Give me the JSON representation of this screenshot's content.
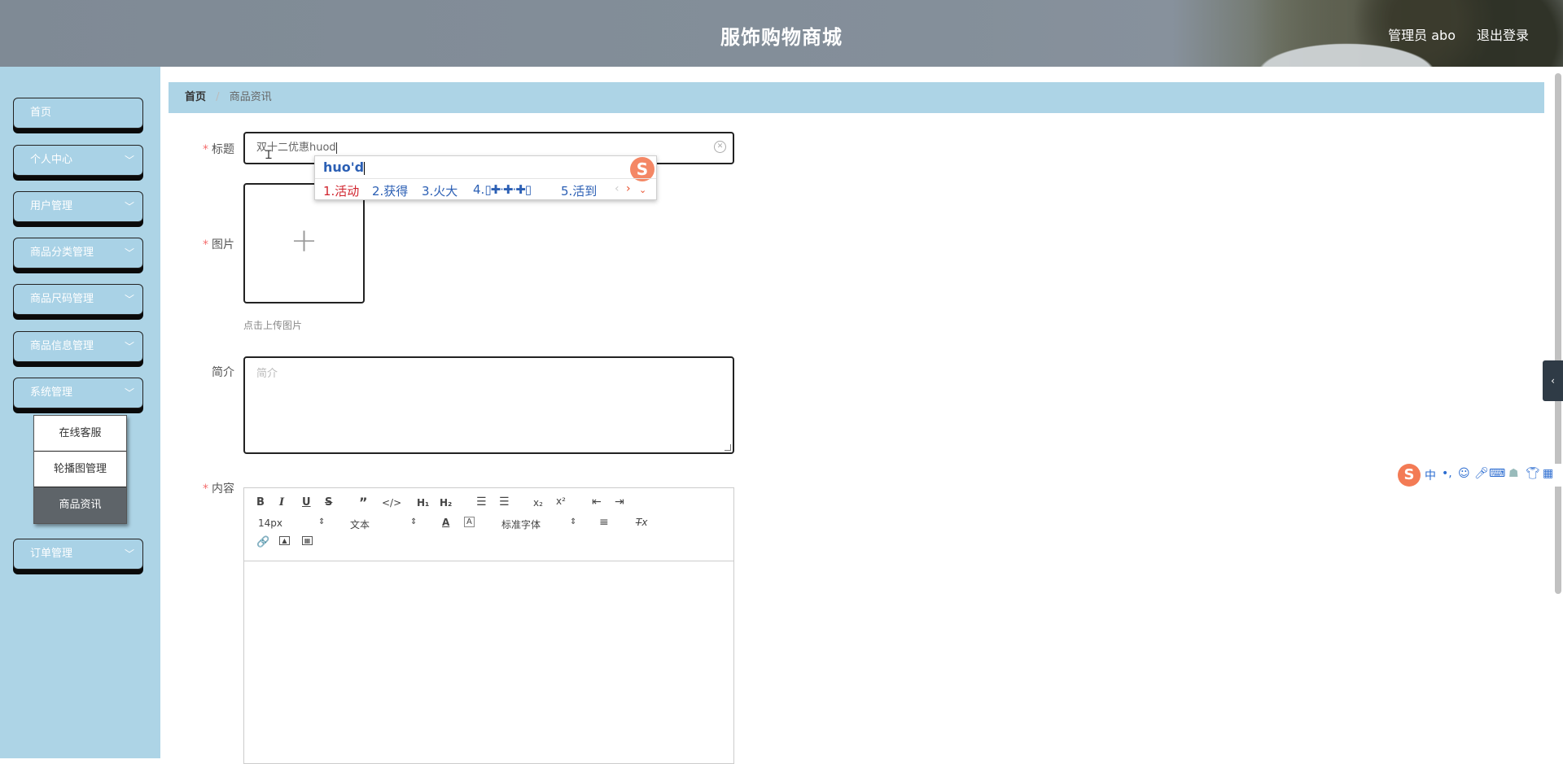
{
  "header": {
    "title": "服饰购物商城",
    "user": "管理员 abo",
    "logout": "退出登录"
  },
  "sidebar": {
    "items": [
      {
        "label": "首页",
        "has_arrow": false
      },
      {
        "label": "个人中心",
        "has_arrow": true
      },
      {
        "label": "用户管理",
        "has_arrow": true
      },
      {
        "label": "商品分类管理",
        "has_arrow": true
      },
      {
        "label": "商品尺码管理",
        "has_arrow": true
      },
      {
        "label": "商品信息管理",
        "has_arrow": true
      },
      {
        "label": "系统管理",
        "has_arrow": true
      },
      {
        "label": "订单管理",
        "has_arrow": true
      }
    ],
    "submenu": [
      {
        "label": "在线客服"
      },
      {
        "label": "轮播图管理"
      },
      {
        "label": "商品资讯",
        "active": true
      }
    ]
  },
  "breadcrumb": {
    "home": "首页",
    "separator": "/",
    "current": "商品资讯"
  },
  "form": {
    "title_label": "标题",
    "title_value": "双十二优惠huod",
    "image_label": "图片",
    "upload_tip": "点击上传图片",
    "intro_label": "简介",
    "intro_placeholder": "简介",
    "content_label": "内容"
  },
  "editor": {
    "font_size": "14px",
    "header_select": "文本",
    "font_family": "标准字体"
  },
  "ime": {
    "composition": "huo'd",
    "candidates": [
      "1.活动",
      "2.获得",
      "3.火大",
      "4.",
      "5.活到"
    ]
  },
  "colors": {
    "sidebar_bg": "#add4e6",
    "required": "#f56c6c",
    "active_submenu": "#5e6469"
  }
}
